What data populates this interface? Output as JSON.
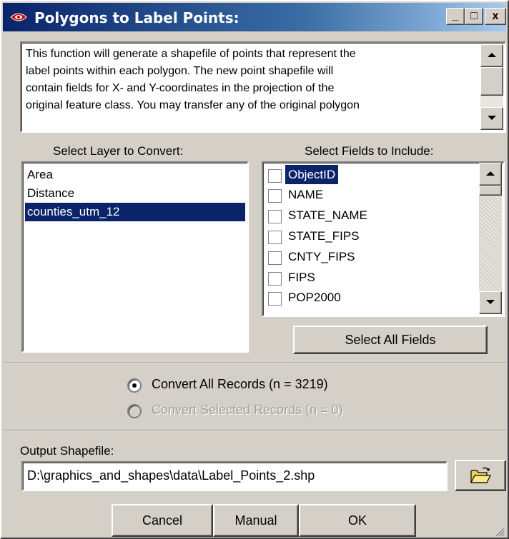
{
  "window": {
    "title": "Polygons to Label Points:",
    "minimize": "_",
    "maximize": "□",
    "close": "x"
  },
  "description": "This function will generate a shapefile of points that represent the\nlabel points within each polygon. The new point shapefile will\ncontain fields for X- and Y-coordinates in the projection of the\noriginal feature class.  You may transfer any of the original polygon",
  "layers": {
    "label": "Select Layer to Convert:",
    "items": [
      "Area",
      "Distance",
      "counties_utm_12"
    ],
    "selected": "counties_utm_12"
  },
  "fields": {
    "label": "Select Fields to Include:",
    "items": [
      "ObjectID",
      "NAME",
      "STATE_NAME",
      "STATE_FIPS",
      "CNTY_FIPS",
      "FIPS",
      "POP2000"
    ],
    "selected": "ObjectID",
    "select_all_label": "Select All Fields"
  },
  "records": {
    "all_label": "Convert All Records (n = 3219)",
    "selected_label": "Convert Selected Records (n = 0)",
    "all_checked": true,
    "selected_enabled": false
  },
  "output": {
    "label": "Output Shapefile:",
    "value": "D:\\graphics_and_shapes\\data\\Label_Points_2.shp"
  },
  "buttons": {
    "cancel": "Cancel",
    "manual": "Manual",
    "ok": "OK"
  },
  "icons": {
    "title": "red-eye-icon",
    "browse": "open-folder-icon",
    "scroll_up": "arrow-up-icon",
    "scroll_down": "arrow-down-icon"
  },
  "colors": {
    "titlebar": "#0a246a",
    "selection": "#0a246a",
    "face": "#d4d0c8"
  }
}
